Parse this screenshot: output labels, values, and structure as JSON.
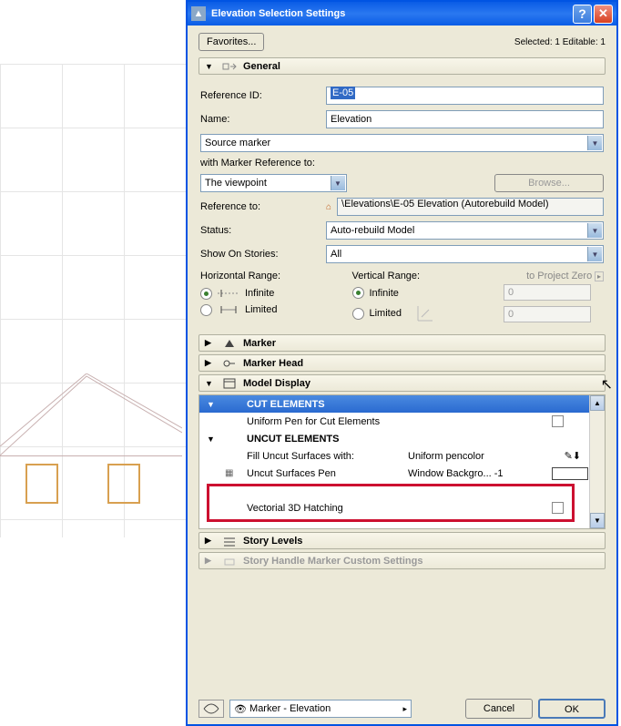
{
  "title": "Elevation Selection Settings",
  "toolbar": {
    "favorites": "Favorites...",
    "status": "Selected: 1 Editable: 1"
  },
  "sections": {
    "general": "General",
    "marker": "Marker",
    "markerHead": "Marker Head",
    "modelDisplay": "Model Display",
    "storyLevels": "Story Levels",
    "storyHandle": "Story Handle Marker Custom Settings"
  },
  "general": {
    "refIdLabel": "Reference ID:",
    "refId": "E-05",
    "nameLabel": "Name:",
    "name": "Elevation",
    "sourceMarker": "Source marker",
    "withMarkerRefLabel": "with Marker Reference to:",
    "viewpoint": "The viewpoint",
    "browse": "Browse...",
    "refToLabel": "Reference to:",
    "refToVal": "\\Elevations\\E-05 Elevation (Autorebuild Model)",
    "statusLabel": "Status:",
    "statusVal": "Auto-rebuild Model",
    "showOnLabel": "Show On Stories:",
    "showOnVal": "All",
    "hRange": "Horizontal Range:",
    "vRange": "Vertical Range:",
    "infinite": "Infinite",
    "limited": "Limited",
    "projZero": "to Project Zero",
    "zero1": "0",
    "zero2": "0"
  },
  "model": {
    "cutElements": "CUT ELEMENTS",
    "uniformPenCut": "Uniform Pen for Cut Elements",
    "uncutElements": "UNCUT ELEMENTS",
    "fillUncutLabel": "Fill Uncut Surfaces with:",
    "fillUncutVal": "Uniform pencolor",
    "uncutPenLabel": "Uncut Surfaces Pen",
    "uncutPenVal": "Window Backgro...  -1",
    "hiddenRow": "",
    "vectorial": "Vectorial 3D Hatching"
  },
  "bottom": {
    "markerElev": "Marker - Elevation",
    "cancel": "Cancel",
    "ok": "OK"
  }
}
